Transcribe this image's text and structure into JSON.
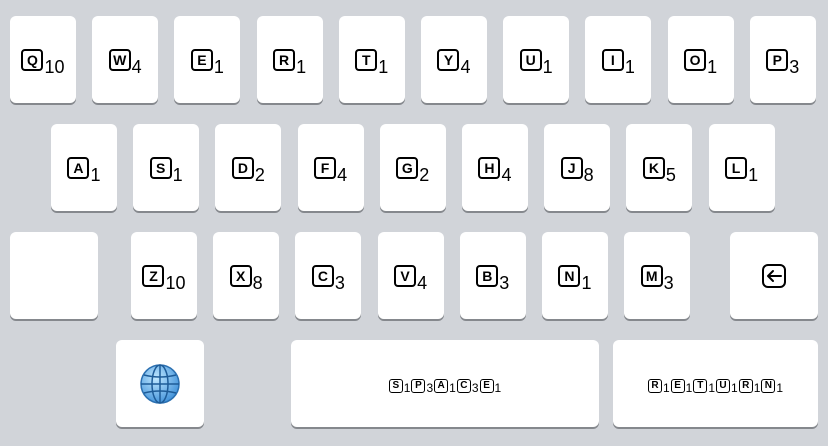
{
  "keyboard": {
    "row1": [
      {
        "letter": "Q",
        "score": "10"
      },
      {
        "letter": "W",
        "score": "4"
      },
      {
        "letter": "E",
        "score": "1"
      },
      {
        "letter": "R",
        "score": "1"
      },
      {
        "letter": "T",
        "score": "1"
      },
      {
        "letter": "Y",
        "score": "4"
      },
      {
        "letter": "U",
        "score": "1"
      },
      {
        "letter": "I",
        "score": "1"
      },
      {
        "letter": "O",
        "score": "1"
      },
      {
        "letter": "P",
        "score": "3"
      }
    ],
    "row2": [
      {
        "letter": "A",
        "score": "1"
      },
      {
        "letter": "S",
        "score": "1"
      },
      {
        "letter": "D",
        "score": "2"
      },
      {
        "letter": "F",
        "score": "4"
      },
      {
        "letter": "G",
        "score": "2"
      },
      {
        "letter": "H",
        "score": "4"
      },
      {
        "letter": "J",
        "score": "8"
      },
      {
        "letter": "K",
        "score": "5"
      },
      {
        "letter": "L",
        "score": "1"
      }
    ],
    "row3": [
      {
        "letter": "Z",
        "score": "10"
      },
      {
        "letter": "X",
        "score": "8"
      },
      {
        "letter": "C",
        "score": "3"
      },
      {
        "letter": "V",
        "score": "4"
      },
      {
        "letter": "B",
        "score": "3"
      },
      {
        "letter": "N",
        "score": "1"
      },
      {
        "letter": "M",
        "score": "3"
      }
    ],
    "space": [
      {
        "letter": "S",
        "score": "1"
      },
      {
        "letter": "P",
        "score": "3"
      },
      {
        "letter": "A",
        "score": "1"
      },
      {
        "letter": "C",
        "score": "3"
      },
      {
        "letter": "E",
        "score": "1"
      }
    ],
    "return": [
      {
        "letter": "R",
        "score": "1"
      },
      {
        "letter": "E",
        "score": "1"
      },
      {
        "letter": "T",
        "score": "1"
      },
      {
        "letter": "U",
        "score": "1"
      },
      {
        "letter": "R",
        "score": "1"
      },
      {
        "letter": "N",
        "score": "1"
      }
    ],
    "icons": {
      "shift": "blank-shift-key",
      "backspace": "backspace-icon",
      "globe": "globe-icon"
    }
  }
}
